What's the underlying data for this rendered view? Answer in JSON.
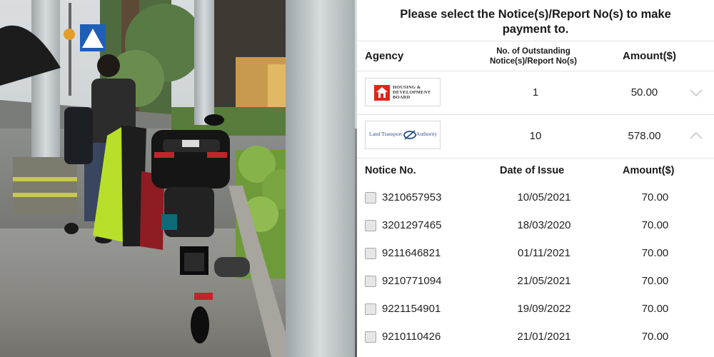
{
  "prompt": "Please select the Notice(s)/Report No(s) to make payment to.",
  "headers": {
    "agency": "Agency",
    "count": "No. of Outstanding Notice(s)/Report No(s)",
    "amount": "Amount($)"
  },
  "agencies": [
    {
      "logo_lines": [
        "HOUSING &",
        "DEVELOPMENT",
        "BOARD"
      ],
      "logo_icon": "hdb-house-icon",
      "count": "1",
      "amount": "50.00",
      "state": "collapsed",
      "chevron_icon": "chevron-down-icon"
    },
    {
      "logo_text": "Land Transport",
      "logo_text2": "Authority",
      "logo_icon": "lta-swirl-icon",
      "count": "10",
      "amount": "578.00",
      "state": "expanded",
      "chevron_icon": "chevron-up-icon"
    }
  ],
  "notice_headers": {
    "notice_no": "Notice No.",
    "date": "Date of Issue",
    "amount": "Amount($)"
  },
  "notices": [
    {
      "no": "3210657953",
      "date": "10/05/2021",
      "amount": "70.00"
    },
    {
      "no": "3201297465",
      "date": "18/03/2020",
      "amount": "70.00"
    },
    {
      "no": "9211646821",
      "date": "01/11/2021",
      "amount": "70.00"
    },
    {
      "no": "9210771094",
      "date": "21/05/2021",
      "amount": "70.00"
    },
    {
      "no": "9221154901",
      "date": "19/09/2022",
      "amount": "70.00"
    },
    {
      "no": "9210110426",
      "date": "21/01/2021",
      "amount": "70.00"
    }
  ],
  "photo": {
    "scene": "motorcycle-parked-on-wet-pavement-photo",
    "sign_icon": "pedestrian-crossing-sign-icon",
    "top_box_badge": "GIVI"
  }
}
